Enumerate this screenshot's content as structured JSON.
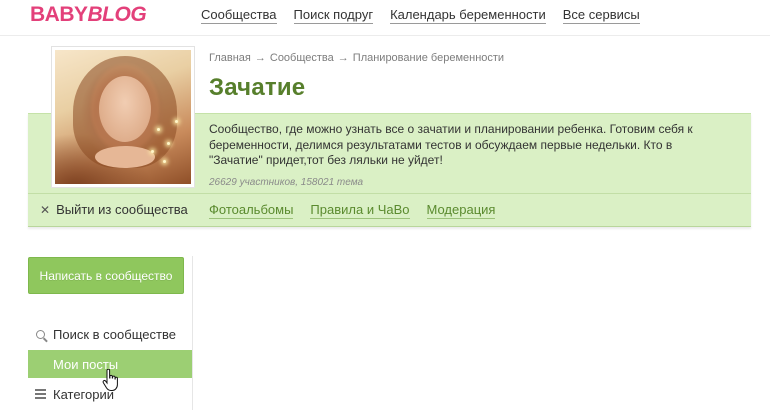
{
  "logo": {
    "part1": "BABY",
    "part2": "BLOG"
  },
  "topnav": [
    {
      "label": "Сообщества"
    },
    {
      "label": "Поиск подруг"
    },
    {
      "label": "Календарь беременности"
    },
    {
      "label": "Все сервисы"
    }
  ],
  "breadcrumb": {
    "items": [
      "Главная",
      "Сообщества",
      "Планирование беременности"
    ],
    "separator": "→"
  },
  "community": {
    "title": "Зачатие",
    "description": "Сообщество, где можно узнать все о зачатии и планировании ребенка. Готовим себя к беременности, делимся результатами тестов и обсуждаем первые недельки. Кто в \"Зачатие\" придет,тот без ляльки не уйдет!",
    "stats": "26629 участников, 158021 тема",
    "leave_label": "Выйти из сообщества",
    "leave_icon": "close-icon",
    "tabs": [
      {
        "label": "Фотоальбомы"
      },
      {
        "label": "Правила и ЧаВо"
      },
      {
        "label": "Модерация"
      }
    ]
  },
  "sidebar": {
    "write_button": "Написать в сообщество",
    "items": [
      {
        "label": "Поиск в сообществе",
        "icon": "search-icon"
      },
      {
        "label": "Мои посты",
        "icon": "",
        "active": true
      },
      {
        "label": "Категории",
        "icon": "menu-icon"
      }
    ]
  },
  "colors": {
    "brand": "#e3407a",
    "title_green": "#577f2c",
    "band": "#daf0c5",
    "button": "#8fc75d",
    "active_item": "#9ccf73",
    "link_green": "#5a8a2e"
  }
}
